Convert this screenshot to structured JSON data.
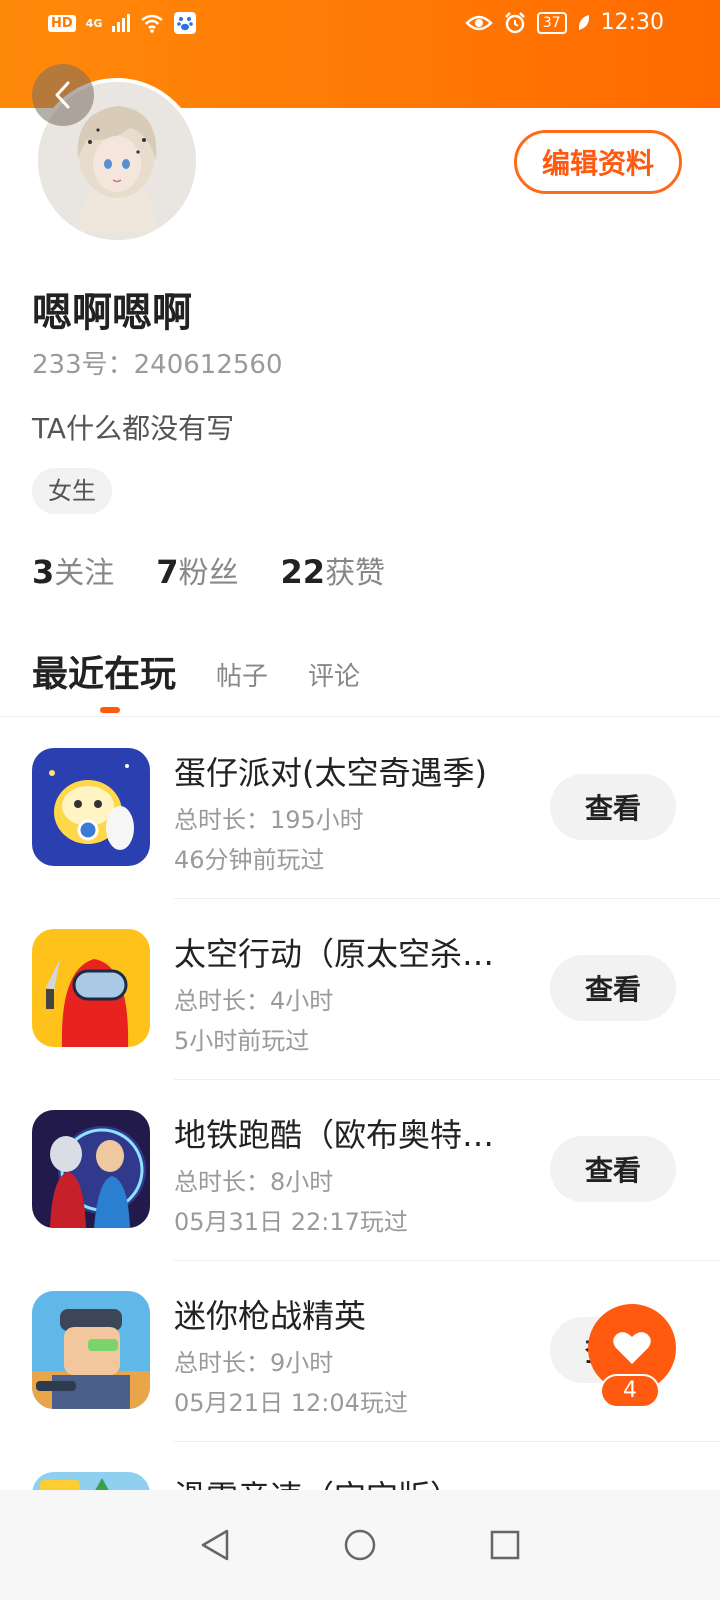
{
  "status_bar": {
    "hd_badge": "HD",
    "network": "4G",
    "time": "12:30",
    "battery": "37"
  },
  "profile": {
    "edit_label": "编辑资料",
    "name": "嗯啊嗯啊",
    "uid": "233号：240612560",
    "bio": "TA什么都没有写",
    "gender": "女生",
    "stats": [
      {
        "value": "3",
        "label": "关注"
      },
      {
        "value": "7",
        "label": "粉丝"
      },
      {
        "value": "22",
        "label": "获赞"
      }
    ]
  },
  "tabs": [
    {
      "label": "最近在玩",
      "active": true
    },
    {
      "label": "帖子",
      "active": false
    },
    {
      "label": "评论",
      "active": false
    }
  ],
  "games": [
    {
      "title": "蛋仔派对(太空奇遇季)",
      "duration": "总时长：195小时",
      "last_played": "46分钟前玩过",
      "button": "查看",
      "icon": "eggy-party-icon"
    },
    {
      "title": "太空行动（原太空杀…",
      "duration": "总时长：4小时",
      "last_played": "5小时前玩过",
      "button": "查看",
      "icon": "space-action-icon"
    },
    {
      "title": "地铁跑酷（欧布奥特…",
      "duration": "总时长：8小时",
      "last_played": "05月31日 22:17玩过",
      "button": "查看",
      "icon": "subway-surfers-icon"
    },
    {
      "title": "迷你枪战精英",
      "duration": "总时长：9小时",
      "last_played": "05月21日 12:04玩过",
      "button": "查看",
      "icon": "mini-gunfight-icon"
    },
    {
      "title": "滑雪竞速（宝宝版）",
      "duration": "",
      "last_played": "",
      "button": "",
      "icon": "ski-race-icon"
    }
  ],
  "like_count": "4",
  "colors": {
    "accent": "#ff5a10",
    "header": "#ff7a00"
  }
}
